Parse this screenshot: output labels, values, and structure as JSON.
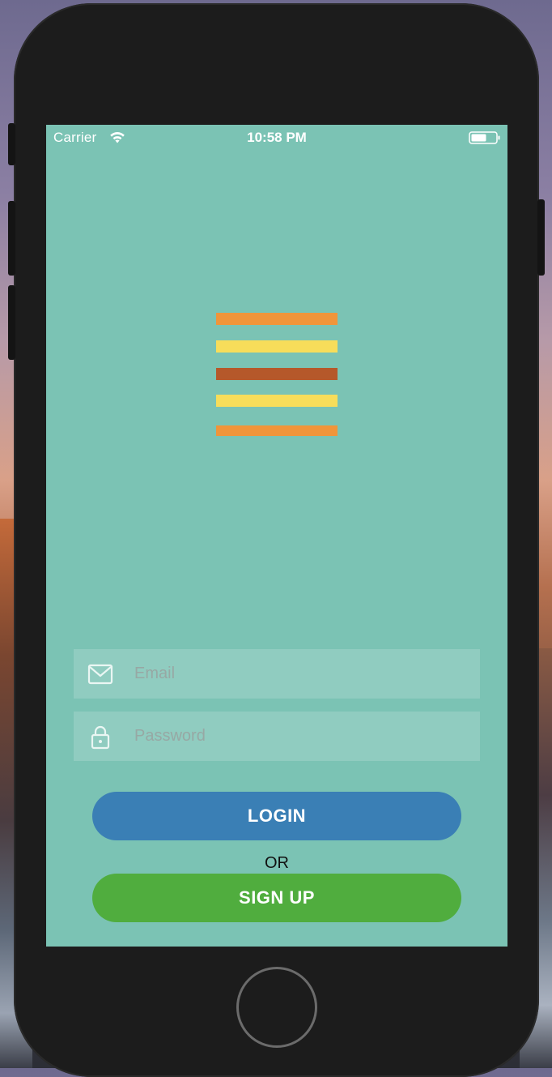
{
  "status_bar": {
    "carrier": "Carrier",
    "time": "10:58 PM",
    "wifi_icon": "wifi-icon",
    "battery_icon": "battery-icon"
  },
  "logo": {
    "icon": "burger-stripes-logo",
    "stripe_colors": [
      "#f0953a",
      "#f7dd5a",
      "#b5582a",
      "#f7dd5a",
      "#f0953a"
    ]
  },
  "form": {
    "email": {
      "icon": "envelope-icon",
      "placeholder": "Email",
      "value": ""
    },
    "password": {
      "icon": "lock-icon",
      "placeholder": "Password",
      "value": ""
    }
  },
  "actions": {
    "login_label": "LOGIN",
    "or_label": "OR",
    "signup_label": "SIGN UP"
  },
  "colors": {
    "screen_bg": "#7bc3b4",
    "login_button": "#3a7fb5",
    "signup_button": "#50ad3e",
    "device_frame": "#1c1c1c"
  }
}
